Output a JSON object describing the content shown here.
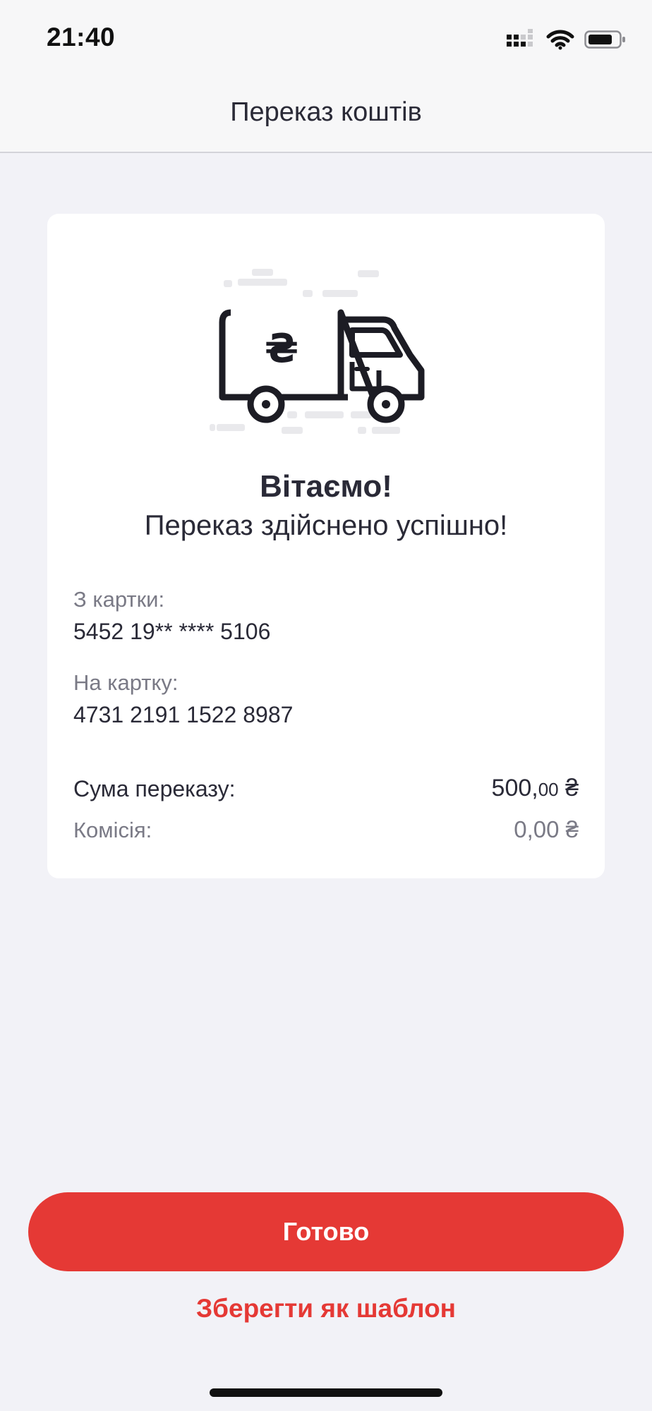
{
  "status_bar": {
    "time": "21:40",
    "icons": [
      "cellular-signal-icon",
      "wifi-icon",
      "battery-icon"
    ]
  },
  "header": {
    "title": "Переказ коштів"
  },
  "card": {
    "illustration": "money-truck-icon",
    "title": "Вітаємо!",
    "message": "Переказ здійснено успішно!",
    "from_label": "З картки:",
    "from_value": "5452 19** **** 5106",
    "to_label": "На картку:",
    "to_value": "4731 2191 1522 8987",
    "sum_label": "Сума переказу:",
    "sum_main": "500,",
    "sum_kop": "00",
    "sum_currency": " ₴",
    "fee_label": "Комісія:",
    "fee_value": "0,00 ₴"
  },
  "actions": {
    "done_label": "Готово",
    "save_template_label": "Зберегти як шаблон"
  },
  "colors": {
    "accent": "#e53935",
    "background": "#f2f2f7",
    "card": "#ffffff",
    "text_primary": "#2a2a37",
    "text_secondary": "#7a7a86"
  }
}
